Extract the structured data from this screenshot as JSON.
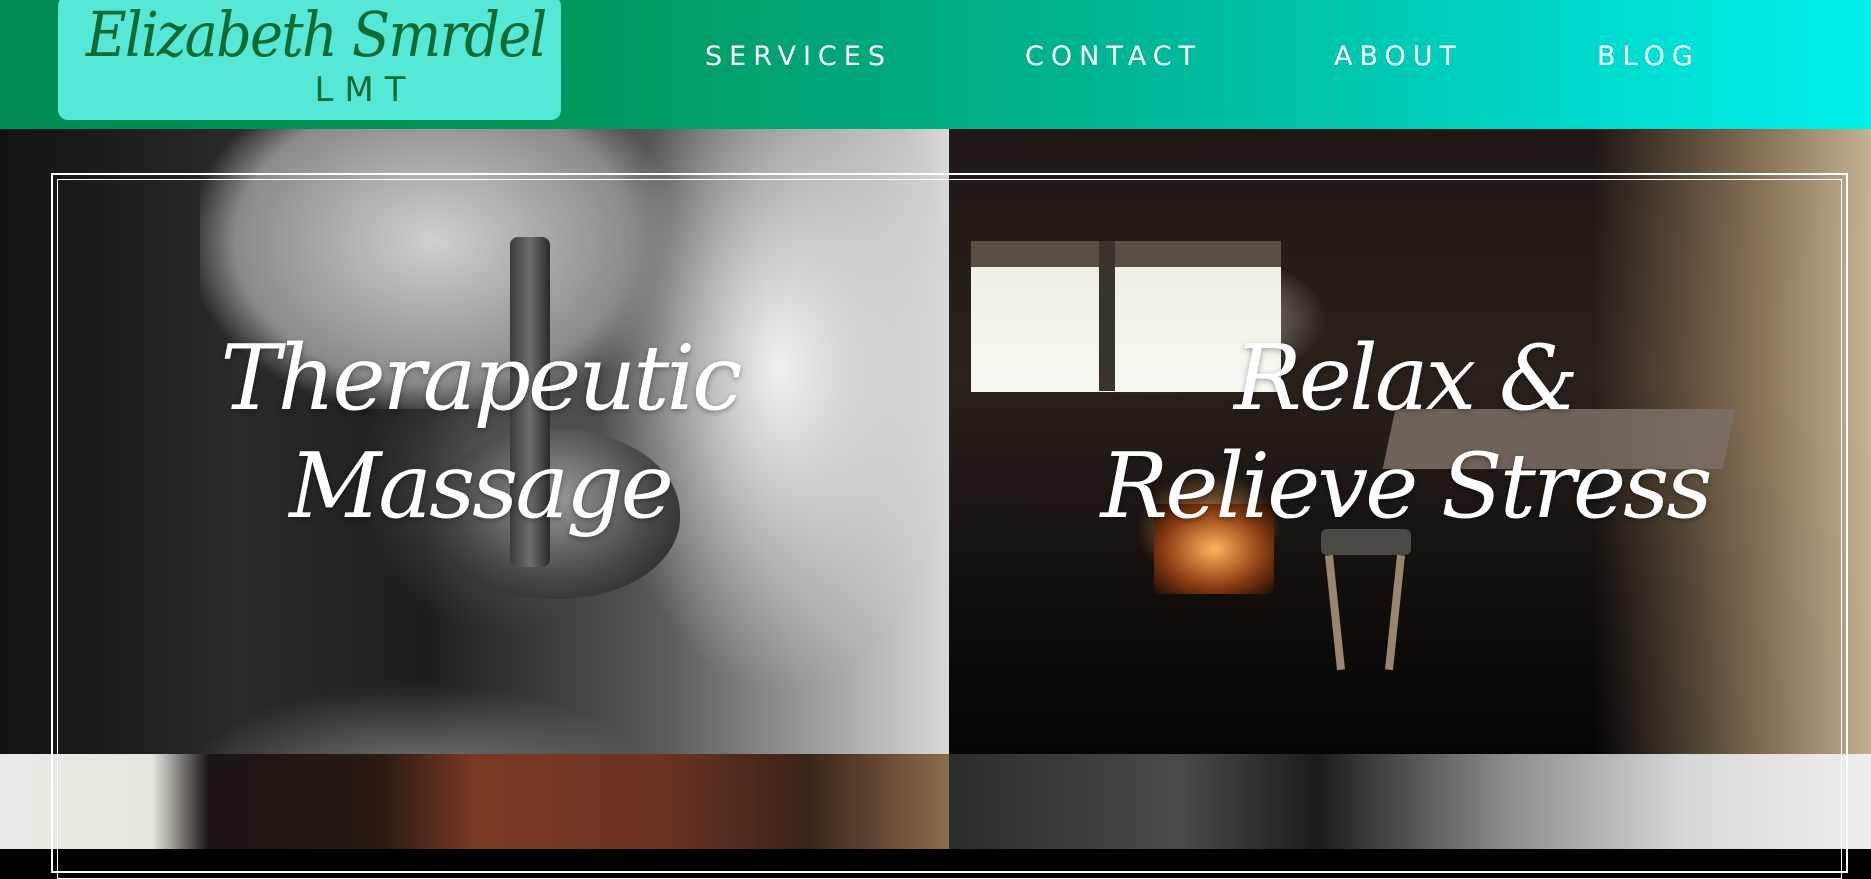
{
  "header": {
    "logo_name": "Elizabeth Smrdel",
    "logo_sub": "LMT",
    "nav": [
      {
        "label": "SERVICES"
      },
      {
        "label": "CONTACT"
      },
      {
        "label": "ABOUT"
      },
      {
        "label": "BLOG"
      }
    ],
    "colors": {
      "gradient_start": "#008a52",
      "gradient_end": "#00f0ee",
      "logo_bg": "#55e8d6",
      "logo_text": "#0f6b32"
    }
  },
  "tiles": [
    {
      "line1": "Therapeutic",
      "line2": "Massage"
    },
    {
      "line1": "Relax &",
      "line2": "Relieve Stress"
    }
  ]
}
